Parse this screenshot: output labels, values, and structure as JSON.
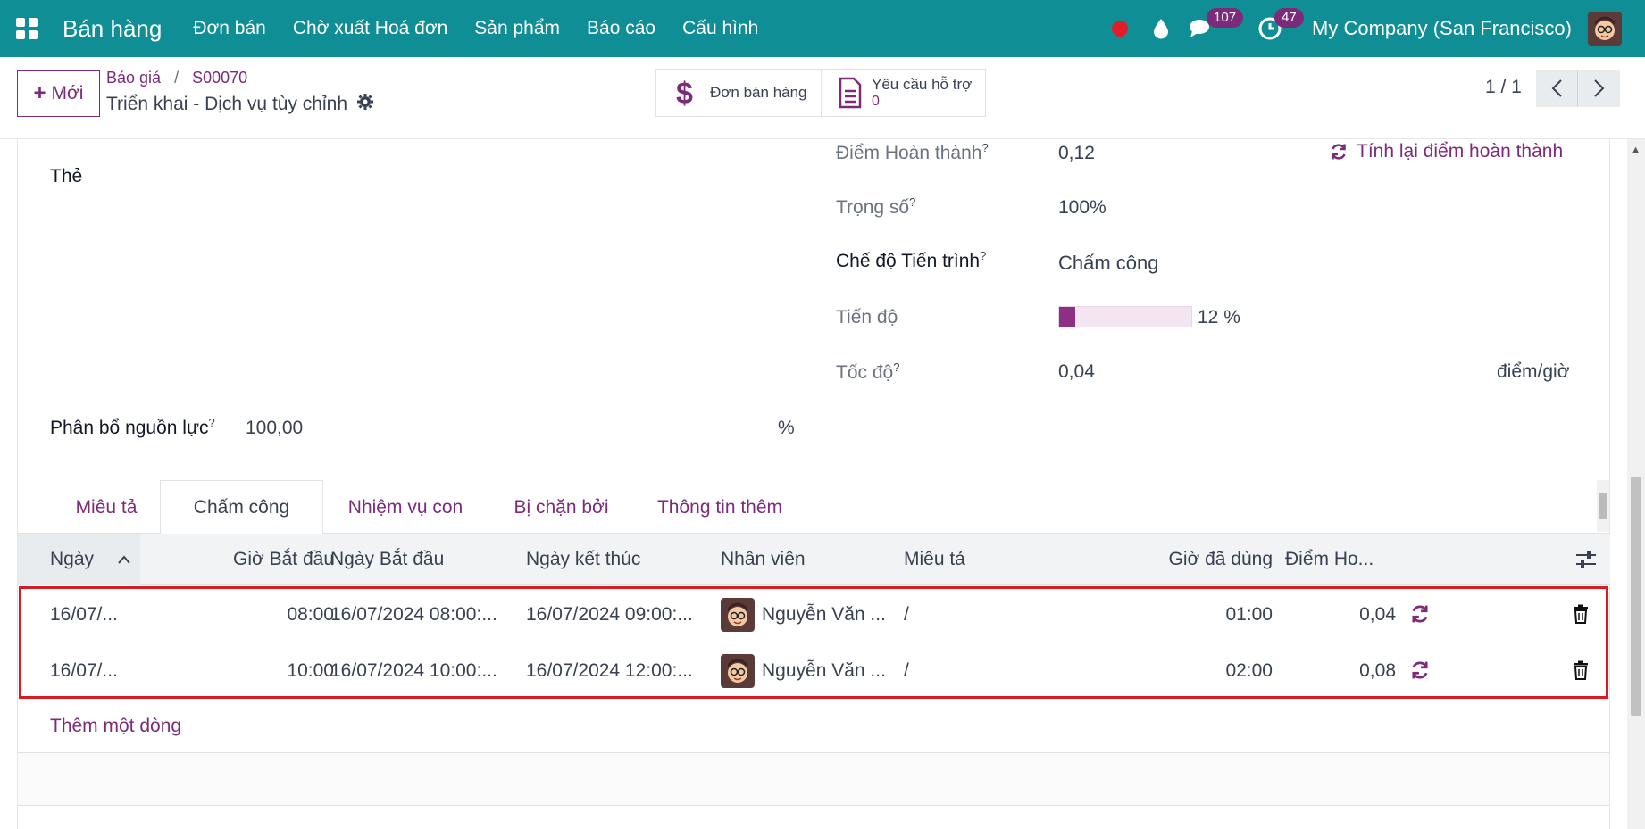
{
  "navbar": {
    "brand": "Bán hàng",
    "menu": [
      "Đơn bán",
      "Chờ xuất Hoá đơn",
      "Sản phẩm",
      "Báo cáo",
      "Cấu hình"
    ],
    "messages_count": "107",
    "activities_count": "47",
    "company": "My Company (San Francisco)"
  },
  "control": {
    "new_label": "Mới",
    "breadcrumb": [
      "Báo giá",
      "S00070"
    ],
    "record_title": "Triển khai - Dịch vụ tùy chỉnh",
    "smart_sales_label": "Đơn bán hàng",
    "smart_support_label": "Yêu cầu hỗ trợ",
    "smart_support_value": "0",
    "pager": "1 / 1"
  },
  "form": {
    "tags_label": "Thẻ",
    "resource_label": "Phân bổ nguồn lực",
    "resource_value": "100,00",
    "resource_unit": "%",
    "completion_label": "Điểm Hoàn thành",
    "completion_value": "0,12",
    "recompute_label": "Tính lại điểm hoàn thành",
    "weight_label": "Trọng số",
    "weight_value": "100%",
    "progress_mode_label": "Chế độ Tiến trình",
    "progress_mode_value": "Chấm công",
    "progress_label": "Tiến độ",
    "progress_value": "12 %",
    "progress_fraction": 0.12,
    "speed_label": "Tốc độ",
    "speed_value": "0,04",
    "speed_unit": "điểm/giờ",
    "help_mark": "?"
  },
  "tabs": [
    "Miêu tả",
    "Chấm công",
    "Nhiệm vụ con",
    "Bị chặn bởi",
    "Thông tin thêm"
  ],
  "active_tab": "Chấm công",
  "table": {
    "headers": [
      "Ngày",
      "Giờ Bắt đầu",
      "Ngày Bắt đầu",
      "Ngày kết thúc",
      "Nhân viên",
      "Miêu tả",
      "Giờ đã dùng",
      "Điểm Ho..."
    ],
    "rows": [
      {
        "date": "16/07/...",
        "start_hour": "08:00",
        "start_date": "16/07/2024 08:00:...",
        "end_date": "16/07/2024 09:00:...",
        "employee": "Nguyễn Văn ...",
        "desc": "/",
        "hours": "01:00",
        "points": "0,04"
      },
      {
        "date": "16/07/...",
        "start_hour": "10:00",
        "start_date": "16/07/2024 10:00:...",
        "end_date": "16/07/2024 12:00:...",
        "employee": "Nguyễn Văn ...",
        "desc": "/",
        "hours": "02:00",
        "points": "0,08"
      }
    ],
    "add_line": "Thêm một dòng"
  },
  "colors": {
    "navbar": "#0f8e96",
    "accent": "#7c2a7a",
    "highlight": "#dc1a22",
    "recording": "#e11d2a"
  }
}
